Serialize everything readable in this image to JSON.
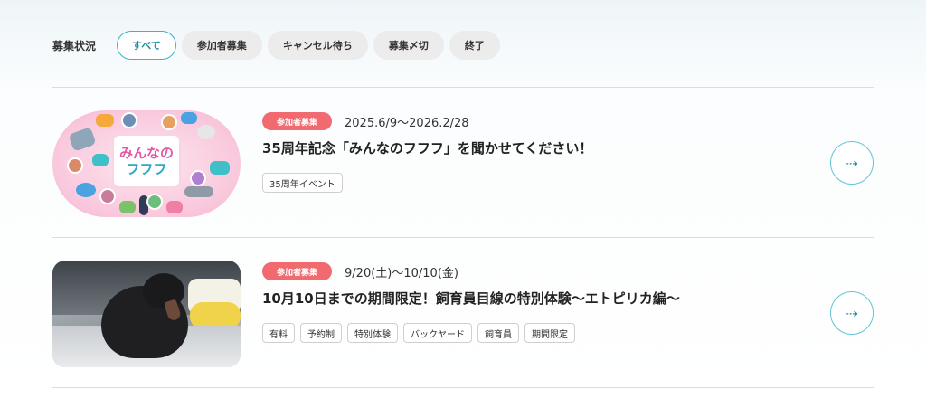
{
  "filter": {
    "label": "募集状況",
    "chips": [
      "すべて",
      "参加者募集",
      "キャンセル待ち",
      "募集〆切",
      "終了"
    ],
    "active_index": 0
  },
  "events": [
    {
      "badge": "参加者募集",
      "date": "2025.6/9〜2026.2/28",
      "title": "35周年記念「みんなのフフフ」を聞かせてください！",
      "tags": [
        "35周年イベント"
      ],
      "thumbnail": {
        "logo_line1": "みんなの",
        "logo_line2": "フフフ"
      }
    },
    {
      "badge": "参加者募集",
      "date": "9/20(土)〜10/10(金)",
      "title": "10月10日までの期間限定！飼育員目線の特別体験〜エトピリカ編〜",
      "tags": [
        "有料",
        "予約制",
        "特別体験",
        "バックヤード",
        "飼育員",
        "期間限定"
      ]
    }
  ],
  "arrow_icon": "arrow-right-icon",
  "colors": {
    "accent": "#3cb4c8",
    "badge": "#f06a6f",
    "chip_bg": "#ececec"
  }
}
